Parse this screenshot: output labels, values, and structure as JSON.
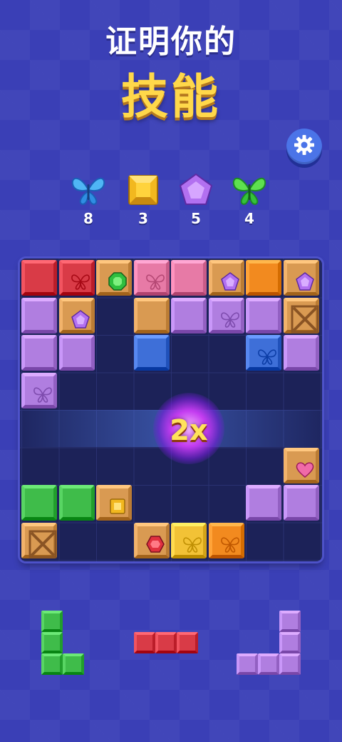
{
  "header": {
    "title_line1": "证明你的",
    "title_line2": "技能"
  },
  "settings": {
    "icon": "gear-icon"
  },
  "goals": [
    {
      "icon": "blue-butterfly-icon",
      "count": "8"
    },
    {
      "icon": "yellow-gem-icon",
      "count": "3"
    },
    {
      "icon": "purple-gem-icon",
      "count": "5"
    },
    {
      "icon": "green-butterfly-icon",
      "count": "4"
    }
  ],
  "colors": {
    "red": "#d93b47",
    "pink": "#e77aa6",
    "orange": "#f28a1f",
    "purple": "#b07ee0",
    "blue": "#3e6fd8",
    "green": "#3fbc4a",
    "wood": "#d99a52",
    "yellow": "#f2c236"
  },
  "board": {
    "size": 8,
    "cells": [
      [
        "red",
        "red-butterfly",
        "wood-green-gem",
        "pink-butterfly",
        "pink",
        "wood-purple-gem",
        "orange",
        "wood-purple-gem"
      ],
      [
        "purple",
        "wood-purple-gem",
        "",
        "wood",
        "purple",
        "purple-butterfly",
        "purple",
        "crate"
      ],
      [
        "purple",
        "purple",
        "",
        "blue",
        "",
        "",
        "blue-butterfly",
        "purple"
      ],
      [
        "purple-butterfly",
        "",
        "",
        "",
        "",
        "",
        "",
        ""
      ],
      [
        "",
        "",
        "",
        "",
        "",
        "",
        "",
        ""
      ],
      [
        "",
        "",
        "",
        "",
        "",
        "",
        "",
        "wood-pink-heart"
      ],
      [
        "green",
        "green",
        "wood-yellow-gem",
        "",
        "",
        "",
        "purple",
        "purple"
      ],
      [
        "crate",
        "",
        "",
        "wood-red-gem",
        "yellow-butterfly",
        "orange-butterfly",
        "",
        ""
      ]
    ]
  },
  "combo": {
    "label": "2x"
  },
  "pieces": [
    {
      "color": "green",
      "shape": "L"
    },
    {
      "color": "red",
      "shape": "I3-horizontal"
    },
    {
      "color": "purple",
      "shape": "J"
    }
  ]
}
